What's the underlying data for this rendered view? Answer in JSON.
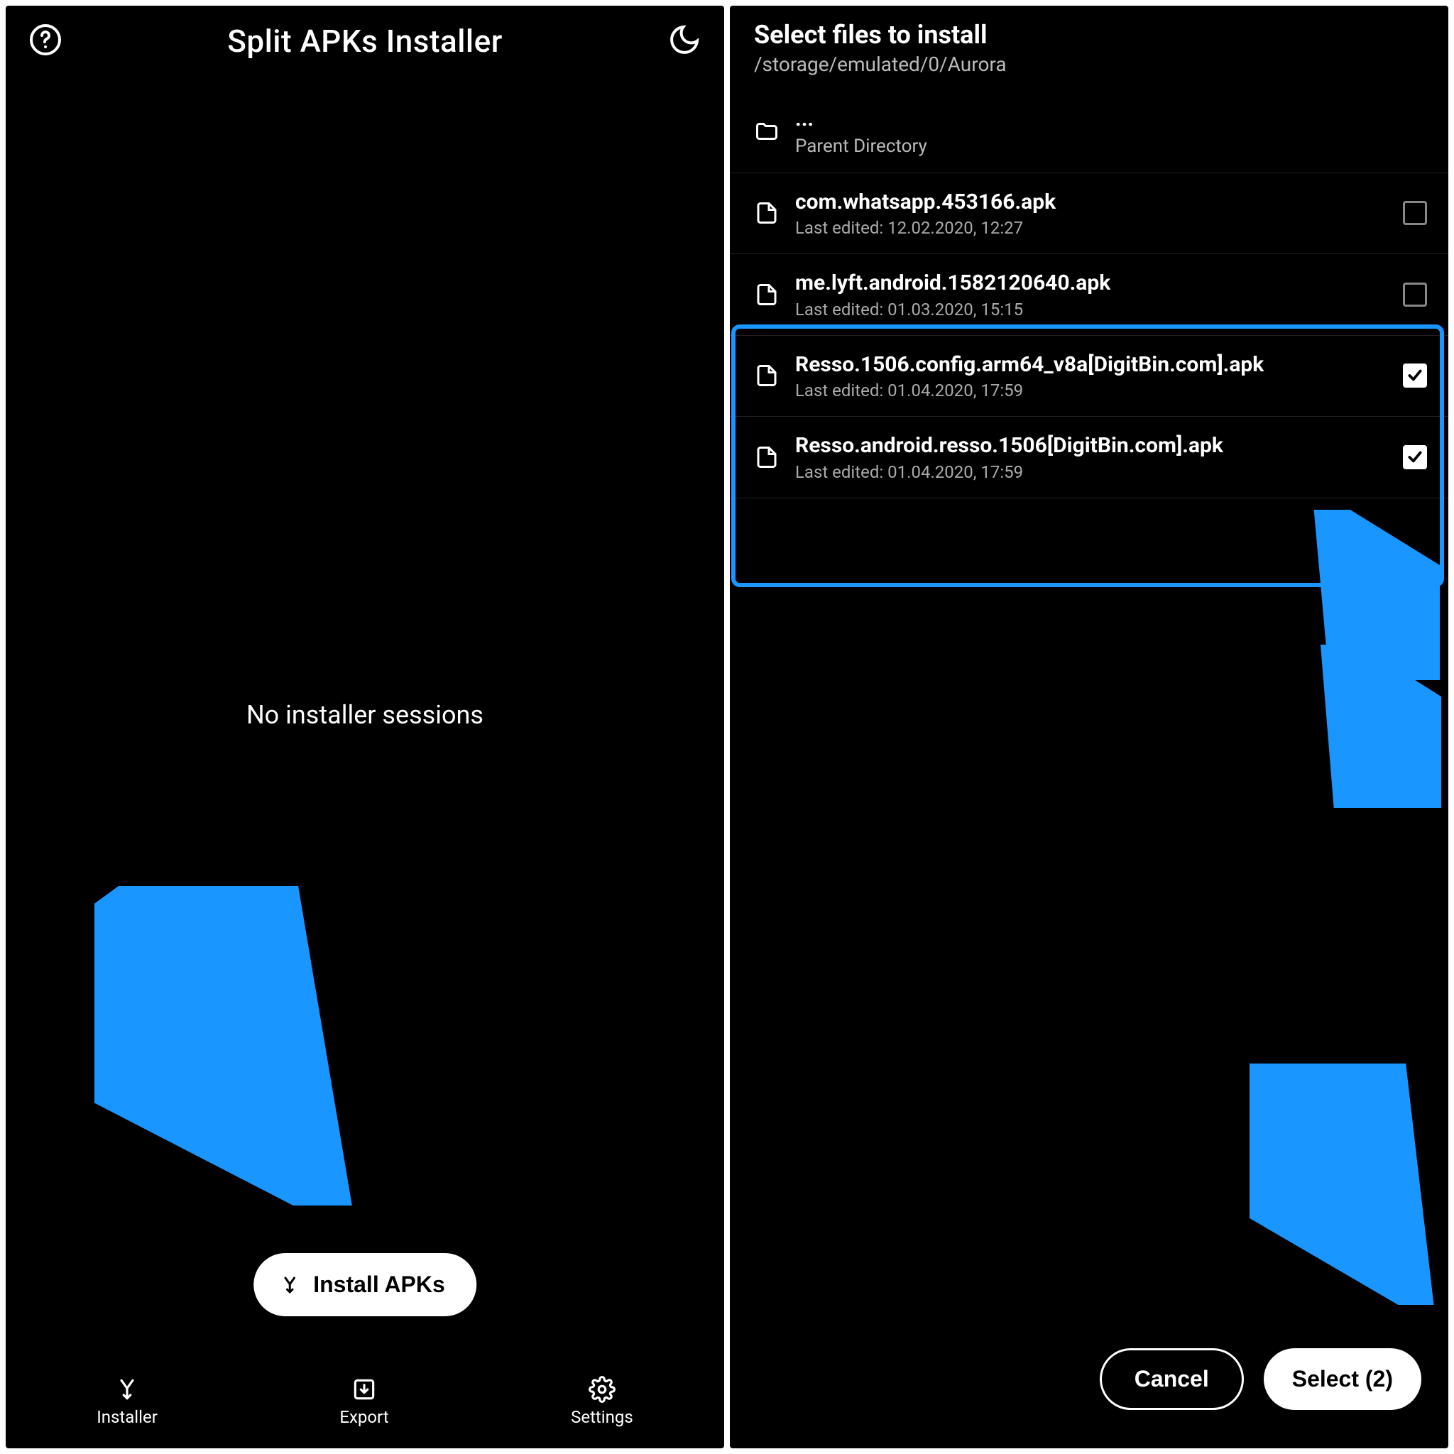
{
  "colors": {
    "accent_arrow": "#1996ff",
    "highlight_border": "#1996ff"
  },
  "left": {
    "title": "Split APKs Installer",
    "empty_message": "No installer sessions",
    "install_button": "Install APKs",
    "nav": {
      "installer": "Installer",
      "export": "Export",
      "settings": "Settings"
    }
  },
  "right": {
    "title": "Select files to install",
    "path": "/storage/emulated/0/Aurora",
    "parent": {
      "dots": "...",
      "label": "Parent Directory"
    },
    "files": [
      {
        "name": "com.whatsapp.453166.apk",
        "meta": "Last edited: 12.02.2020, 12:27",
        "checked": false
      },
      {
        "name": "me.lyft.android.1582120640.apk",
        "meta": "Last edited: 01.03.2020, 15:15",
        "checked": false
      },
      {
        "name": "Resso.1506.config.arm64_v8a[DigitBin.com].apk",
        "meta": "Last edited: 01.04.2020, 17:59",
        "checked": true
      },
      {
        "name": "Resso.android.resso.1506[DigitBin.com].apk",
        "meta": "Last edited: 01.04.2020, 17:59",
        "checked": true
      }
    ],
    "cancel": "Cancel",
    "select": "Select (2)"
  }
}
